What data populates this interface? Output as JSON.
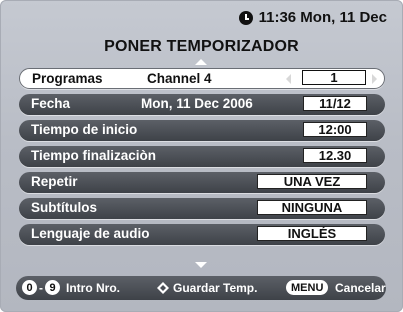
{
  "header": {
    "clock_text": "11:36 Mon, 11 Dec",
    "title": "PONER TEMPORIZADOR"
  },
  "rows": [
    {
      "label": "Programas",
      "mid": "Channel 4",
      "value": "1"
    },
    {
      "label": "Fecha",
      "mid": "Mon, 11 Dec 2006",
      "value": "11/12"
    },
    {
      "label": "Tiempo de inicio",
      "value": "12:00"
    },
    {
      "label": "Tiempo finalizaciòn",
      "value": "12.30"
    },
    {
      "label": "Repetir",
      "value": "UNA VEZ"
    },
    {
      "label": "Subtítulos",
      "value": "NINGUNA"
    },
    {
      "label": "Lenguaje de audio",
      "value": "INGLÉS"
    }
  ],
  "footer": {
    "key_zero": "0",
    "dash": "-",
    "key_nine": "9",
    "intro_label": "Intro Nro.",
    "save_label": "Guardar Temp.",
    "menu_key": "MENU",
    "cancel_label": "Cancelar"
  },
  "colors": {
    "background": "#bfc3cb",
    "row_dark": "#4a4e55",
    "row_selected": "#ffffff",
    "text": "#111111"
  },
  "icons": [
    "clock-icon",
    "up-arrow-icon",
    "down-arrow-icon",
    "left-arrow-icon",
    "right-arrow-icon",
    "navigation-pad-icon"
  ]
}
